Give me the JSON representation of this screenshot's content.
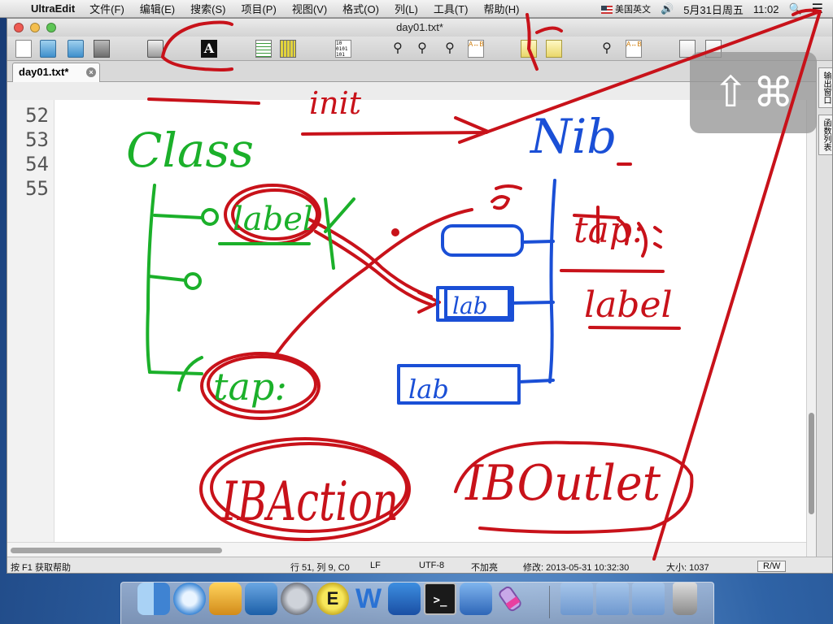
{
  "menubar": {
    "apple": "",
    "app_name": "UltraEdit",
    "items": [
      "文件(F)",
      "编辑(E)",
      "搜索(S)",
      "项目(P)",
      "视图(V)",
      "格式(O)",
      "列(L)",
      "工具(T)",
      "帮助(H)"
    ],
    "input_source": "美国英文",
    "date": "5月31日周五",
    "time": "11:02"
  },
  "window": {
    "title": "day01.txt*",
    "tab_label": "day01.txt*"
  },
  "toolbar": {
    "font_button_label": "A",
    "binary_label": "10\n0101\n101"
  },
  "editor": {
    "line_numbers": [
      "52",
      "53",
      "54",
      "55"
    ]
  },
  "side_panel": {
    "tabs": [
      "输出窗口",
      "函数列表"
    ]
  },
  "statusbar": {
    "help": "按 F1 获取帮助",
    "position": "行 51, 列 9, C0",
    "line_ending": "LF",
    "encoding": "UTF-8",
    "highlight": "不加亮",
    "modified": "修改: 2013-05-31 10:32:30",
    "size": "大小: 1037",
    "mode": "R/W"
  },
  "hud": {
    "shift_symbol": "⇧",
    "command_symbol": "⌘"
  },
  "dock": {
    "word_label": "W",
    "terminal_label": ">_",
    "ue_label": "E"
  },
  "annotation": {
    "words": {
      "init": "init",
      "class": "Class",
      "nib": "Nib",
      "label_green": "label",
      "tap_green": "tap:",
      "lab_blue_mid": "lab",
      "lab_blue_bottom": "lab",
      "tap_red": "tap:",
      "label_red": "label",
      "ibaction": "IBAction",
      "iboutlet": "IBOutlet"
    },
    "colors": {
      "red": "#c8121a",
      "green": "#1bb02a",
      "blue": "#1a4fd6"
    }
  }
}
